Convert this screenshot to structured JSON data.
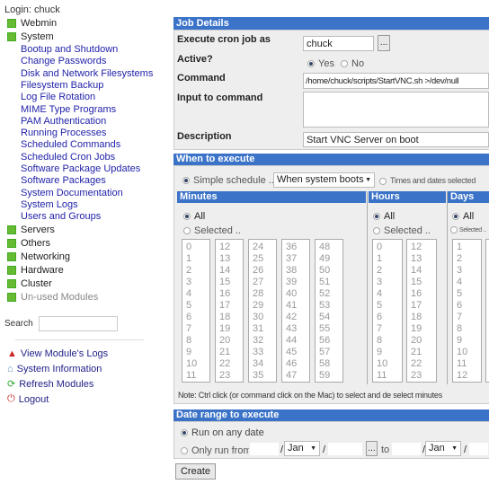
{
  "sidebar": {
    "login": "Login: chuck",
    "categories_top": [
      {
        "label": "Webmin"
      },
      {
        "label": "System"
      }
    ],
    "system_modules": [
      "Bootup and Shutdown",
      "Change Passwords",
      "Disk and Network Filesystems",
      "Filesystem Backup",
      "Log File Rotation",
      "MIME Type Programs",
      "PAM Authentication",
      "Running Processes",
      "Scheduled Commands",
      "Scheduled Cron Jobs",
      "Software Package Updates",
      "Software Packages",
      "System Documentation",
      "System Logs",
      "Users and Groups"
    ],
    "categories_bottom": [
      {
        "label": "Servers"
      },
      {
        "label": "Others"
      },
      {
        "label": "Networking"
      },
      {
        "label": "Hardware"
      },
      {
        "label": "Cluster"
      },
      {
        "label": "Un-used Modules"
      }
    ],
    "search_label": "Search",
    "search_value": "",
    "links": [
      {
        "label": "View Module's Logs",
        "icon": "warning-icon"
      },
      {
        "label": "System Information",
        "icon": "house-icon"
      },
      {
        "label": "Refresh Modules",
        "icon": "refresh-icon"
      },
      {
        "label": "Logout",
        "icon": "power-icon"
      }
    ]
  },
  "job": {
    "header": "Job Details",
    "execute_as_label": "Execute cron job as",
    "execute_as_value": "chuck",
    "browse": "...",
    "active_label": "Active?",
    "yes": "Yes",
    "no": "No",
    "active": "Yes",
    "command_label": "Command",
    "command_value": "/home/chuck/scripts/StartVNC.sh >/dev/null",
    "input_label": "Input to command",
    "input_value": "",
    "description_label": "Description",
    "description_value": "Start VNC Server on boot"
  },
  "when": {
    "header": "When to execute",
    "simple_label": "Simple schedule ..",
    "simple_value": "When system boots",
    "times_label": "Times and dates selected",
    "minutes": {
      "header": "Minutes",
      "all": "All",
      "selected": "Selected .."
    },
    "hours": {
      "header": "Hours",
      "all": "All",
      "selected": "Selected .."
    },
    "days": {
      "header": "Days",
      "all": "All",
      "selected": "Selected .."
    },
    "note": "Note: Ctrl click (or command click on the Mac) to select and de select minutes"
  },
  "daterange": {
    "header": "Date range to execute",
    "any": "Run on any date",
    "only": "Only run from",
    "month_from": "Jan",
    "month_to": "Jan",
    "to": "to",
    "browse": "..."
  },
  "create": "Create",
  "colors": {
    "header": "#3b73c8",
    "link": "#2222aa"
  }
}
